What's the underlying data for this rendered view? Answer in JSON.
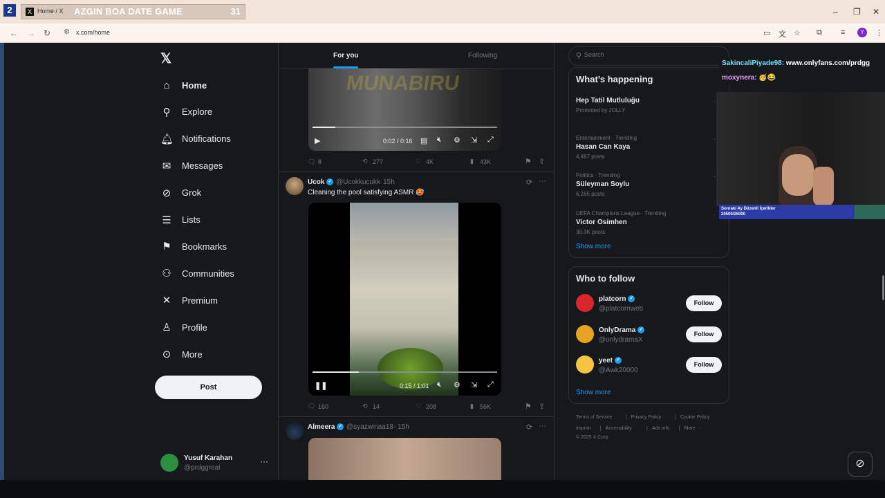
{
  "stream_overlay": {
    "badge": "2",
    "title": "AZGIN BOA DATE GAME",
    "counter": "31",
    "chat": [
      {
        "user": "SakincaliPiyade98:",
        "message": "www.onlyfans.com/prdgg"
      },
      {
        "user": "moxynera:",
        "message": "🥳😂"
      }
    ],
    "sub_goal_label": "Sonraki Ay Düzenli İçerikler",
    "sub_goal_value": "20500/25000"
  },
  "browser": {
    "tab_title": "Home / X",
    "url": "x.com/home",
    "profile_initial": "Y"
  },
  "nav": {
    "items": [
      {
        "label": "Home",
        "icon": "home-icon",
        "glyph": "⌂"
      },
      {
        "label": "Explore",
        "icon": "search-icon",
        "glyph": "⚲"
      },
      {
        "label": "Notifications",
        "icon": "bell-icon",
        "glyph": "🔔︎"
      },
      {
        "label": "Messages",
        "icon": "envelope-icon",
        "glyph": "✉"
      },
      {
        "label": "Grok",
        "icon": "grok-icon",
        "glyph": "⊘"
      },
      {
        "label": "Lists",
        "icon": "list-icon",
        "glyph": "☰"
      },
      {
        "label": "Bookmarks",
        "icon": "bookmark-icon",
        "glyph": "⚑"
      },
      {
        "label": "Communities",
        "icon": "communities-icon",
        "glyph": "⚇"
      },
      {
        "label": "Premium",
        "icon": "x-icon",
        "glyph": "✕"
      },
      {
        "label": "Profile",
        "icon": "person-icon",
        "glyph": "♙"
      },
      {
        "label": "More",
        "icon": "more-circle-icon",
        "glyph": "⊙"
      }
    ],
    "post_label": "Post",
    "user_name": "Yusuf Karahan",
    "user_handle": "@prdggreal"
  },
  "feed": {
    "tabs": [
      "For you",
      "Following"
    ],
    "video1": {
      "time": "0:02 / 0:16",
      "progress": 0.125
    },
    "tweet1_stats": {
      "replies": "8",
      "reposts": "277",
      "likes": "4K",
      "views": "43K"
    },
    "tweet2": {
      "name": "Ucok",
      "handle": "@Ucokkucokk",
      "time": "15h",
      "text": "Cleaning the pool satisfying ASMR 🥵",
      "video_time": "0:15 / 1:01",
      "progress": 0.25,
      "stats": {
        "replies": "160",
        "reposts": "14",
        "likes": "208",
        "views": "56K"
      }
    },
    "tweet3": {
      "name": "Almeera",
      "handle": "@syazwinaa18",
      "time": "15h"
    }
  },
  "sidebar": {
    "search_placeholder": "Search",
    "whats_happening_title": "What’s happening",
    "trends": [
      {
        "category": "",
        "title": "Hep Tatil Mutluluğu",
        "sub": "Promoted by JOLLY"
      },
      {
        "category": "Entertainment · Trending",
        "title": "Hasan Can Kaya",
        "sub": "4,467 posts"
      },
      {
        "category": "Politics · Trending",
        "title": "Süleyman Soylu",
        "sub": "6,265 posts"
      },
      {
        "category": "UEFA Champions League · Trending",
        "title": "Victor Osimhen",
        "sub": "30.3K posts"
      }
    ],
    "show_more": "Show more",
    "who_to_follow_title": "Who to follow",
    "follow": [
      {
        "name": "platcorn",
        "handle": "@platcornweb",
        "color": "#d9262c"
      },
      {
        "name": "OnlyDrama",
        "handle": "@onlydramaX",
        "color": "#e6a322"
      },
      {
        "name": "yeet",
        "handle": "@Awk20000",
        "color": "#f5c542"
      }
    ],
    "follow_label": "Follow",
    "footer": {
      "row1": [
        "Terms of Service",
        "Privacy Policy",
        "Cookie Policy"
      ],
      "row2": [
        "Imprint",
        "Accessibility",
        "Ads info",
        "More ···"
      ],
      "copyright": "© 2025 X Corp."
    }
  },
  "colors": {
    "accent": "#1d9bf0",
    "background": "#16181c",
    "border": "#2f3336"
  }
}
